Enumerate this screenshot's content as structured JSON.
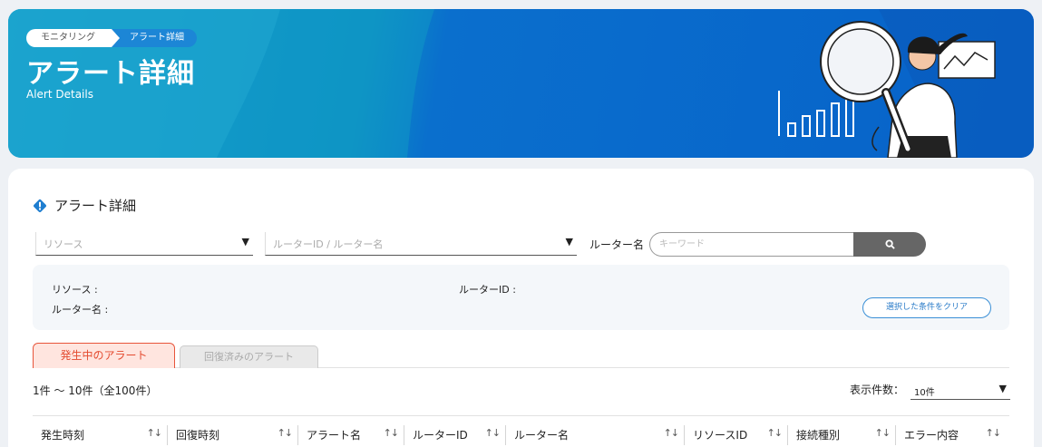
{
  "breadcrumb": [
    "モニタリング",
    "アラート詳細"
  ],
  "banner": {
    "title": "アラート詳細",
    "subtitle": "Alert Details"
  },
  "section": {
    "title": "アラート詳細"
  },
  "filters": {
    "resource_placeholder": "リソース",
    "router_id_placeholder": "ルーターID / ルーター名",
    "router_name_label": "ルーター名",
    "keyword_placeholder": "キーワード"
  },
  "conditions": {
    "resource_label": "リソース :",
    "router_id_label": "ルーターID :",
    "router_name_label": "ルーター名 :",
    "clear_button": "選択した条件をクリア"
  },
  "tabs": [
    {
      "label": "発生中のアラート",
      "active": true
    },
    {
      "label": "回復済みのアラート",
      "active": false
    }
  ],
  "list": {
    "count_text": "1件 ～ 10件（全100件）",
    "per_page_label": "表示件数：",
    "per_page_value": "10件"
  },
  "table": {
    "columns": [
      "発生時刻",
      "回復時刻",
      "アラート名",
      "ルーターID",
      "ルーター名",
      "リソースID",
      "接続種別",
      "エラー内容"
    ],
    "sort_glyph": "↑↓"
  },
  "colors": {
    "accent": "#e8543a",
    "banner": "#0762c9",
    "link": "#2a7bc8"
  }
}
